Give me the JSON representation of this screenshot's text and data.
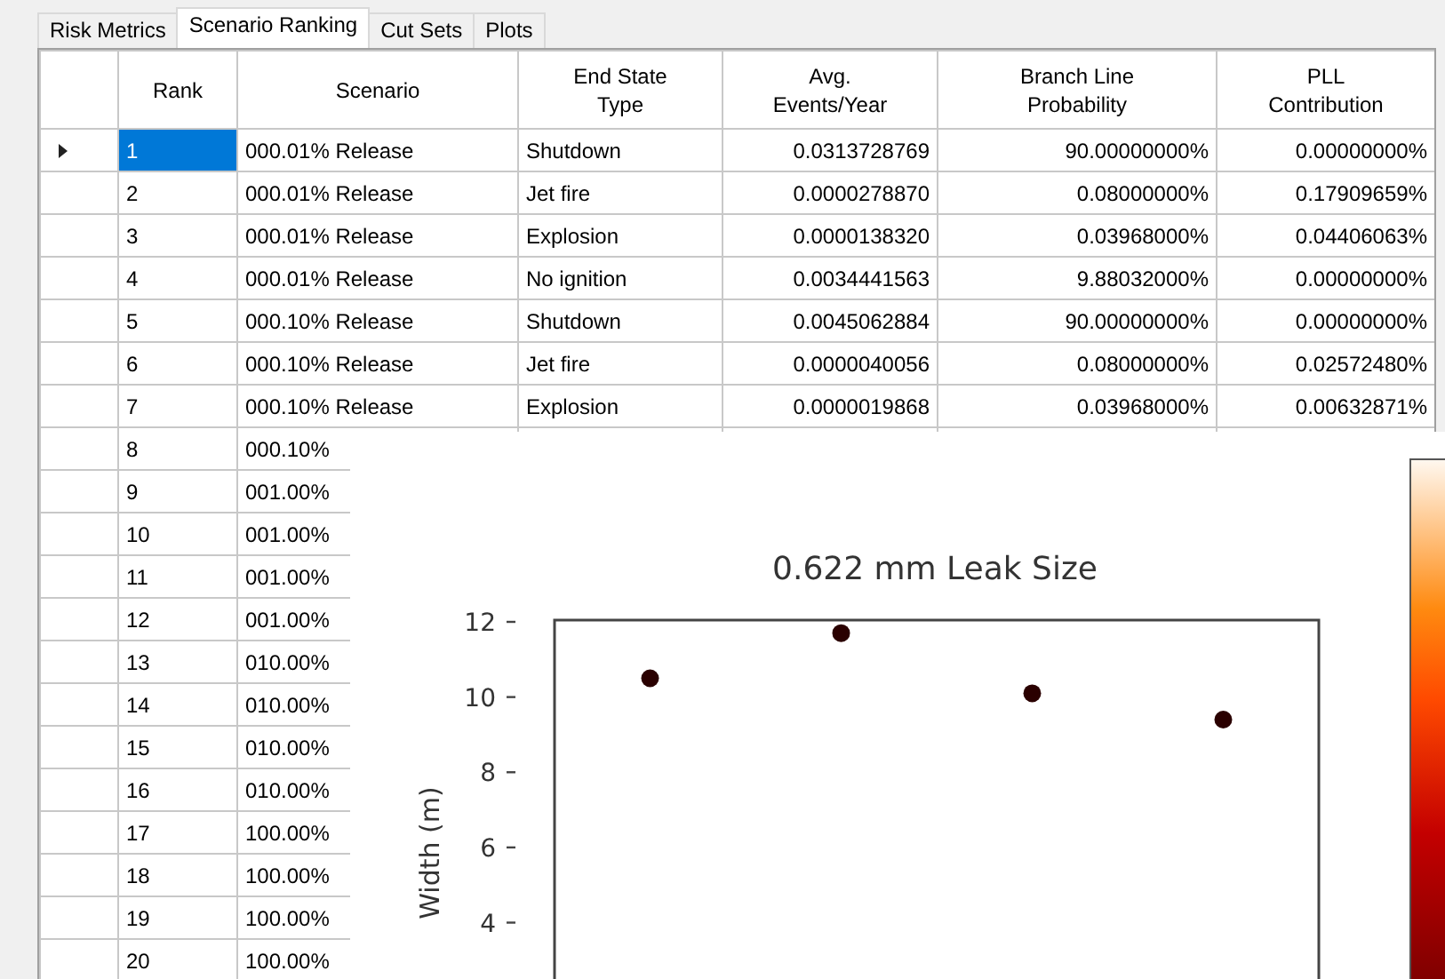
{
  "tabs": [
    {
      "label": "Risk Metrics",
      "selected": false
    },
    {
      "label": "Scenario Ranking",
      "selected": true
    },
    {
      "label": "Cut Sets",
      "selected": false
    },
    {
      "label": "Plots",
      "selected": false
    }
  ],
  "table": {
    "columns": [
      "Rank",
      "Scenario",
      "End State Type",
      "Avg. Events/Year",
      "Branch Line Probability",
      "PLL Contribution"
    ],
    "rows": [
      {
        "selected": true,
        "cells": [
          "1",
          "000.01% Release",
          "Shutdown",
          "0.0313728769",
          "90.00000000%",
          "0.00000000%"
        ]
      },
      {
        "selected": false,
        "cells": [
          "2",
          "000.01% Release",
          "Jet fire",
          "0.0000278870",
          "0.08000000%",
          "0.17909659%"
        ]
      },
      {
        "selected": false,
        "cells": [
          "3",
          "000.01% Release",
          "Explosion",
          "0.0000138320",
          "0.03968000%",
          "0.04406063%"
        ]
      },
      {
        "selected": false,
        "cells": [
          "4",
          "000.01% Release",
          "No ignition",
          "0.0034441563",
          "9.88032000%",
          "0.00000000%"
        ]
      },
      {
        "selected": false,
        "cells": [
          "5",
          "000.10% Release",
          "Shutdown",
          "0.0045062884",
          "90.00000000%",
          "0.00000000%"
        ]
      },
      {
        "selected": false,
        "cells": [
          "6",
          "000.10% Release",
          "Jet fire",
          "0.0000040056",
          "0.08000000%",
          "0.02572480%"
        ]
      },
      {
        "selected": false,
        "cells": [
          "7",
          "000.10% Release",
          "Explosion",
          "0.0000019868",
          "0.03968000%",
          "0.00632871%"
        ]
      },
      {
        "selected": false,
        "cells": [
          "8",
          "000.10%"
        ]
      },
      {
        "selected": false,
        "cells": [
          "9",
          "001.00%"
        ]
      },
      {
        "selected": false,
        "cells": [
          "10",
          "001.00%"
        ]
      },
      {
        "selected": false,
        "cells": [
          "11",
          "001.00%"
        ]
      },
      {
        "selected": false,
        "cells": [
          "12",
          "001.00%"
        ]
      },
      {
        "selected": false,
        "cells": [
          "13",
          "010.00%"
        ]
      },
      {
        "selected": false,
        "cells": [
          "14",
          "010.00%"
        ]
      },
      {
        "selected": false,
        "cells": [
          "15",
          "010.00%"
        ]
      },
      {
        "selected": false,
        "cells": [
          "16",
          "010.00%"
        ]
      },
      {
        "selected": false,
        "cells": [
          "17",
          "100.00%"
        ]
      },
      {
        "selected": false,
        "cells": [
          "18",
          "100.00%"
        ]
      },
      {
        "selected": false,
        "cells": [
          "19",
          "100.00%"
        ]
      },
      {
        "selected": false,
        "cells": [
          "20",
          "100.00%"
        ]
      }
    ]
  },
  "plot": {
    "chart_data": {
      "type": "scatter",
      "title": "0.622 mm Leak Size",
      "ylabel": "Width (m)",
      "ylim": [
        2.5,
        12
      ],
      "yticks": [
        12,
        10,
        8,
        6,
        4
      ],
      "categories": [
        null,
        null,
        null,
        null
      ],
      "series": [
        {
          "color": "#2a0000",
          "values": [
            10.5,
            11.7,
            10.1,
            9.4
          ]
        }
      ]
    }
  }
}
